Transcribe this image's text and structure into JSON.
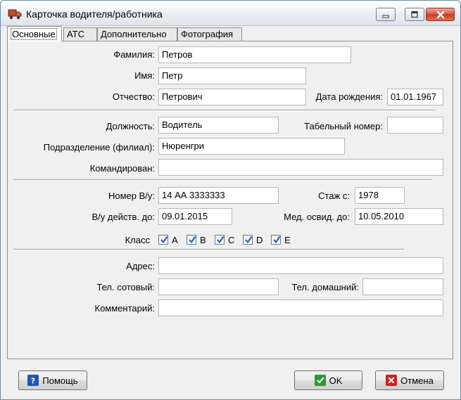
{
  "window": {
    "title": "Карточка водителя/работника"
  },
  "tabs": [
    {
      "label": "Основные",
      "active": true
    },
    {
      "label": "АТС"
    },
    {
      "label": "Дополнительно"
    },
    {
      "label": "Фотография"
    }
  ],
  "form": {
    "last_name": {
      "label": "Фамилия:",
      "value": "Петров"
    },
    "first_name": {
      "label": "Имя:",
      "value": "Петр"
    },
    "patronymic": {
      "label": "Отчество:",
      "value": "Петрович"
    },
    "birth_date": {
      "label": "Дата рождения:",
      "value": "01.01.1967"
    },
    "position": {
      "label": "Должность:",
      "value": "Водитель"
    },
    "personnel_number": {
      "label": "Табельный номер:",
      "value": ""
    },
    "division": {
      "label": "Подразделение (филиал):",
      "value": "Нюренгри"
    },
    "assigned": {
      "label": "Командирован:",
      "value": ""
    },
    "license_number": {
      "label": "Номер В/у:",
      "value": "14 АА 3333333"
    },
    "experience_since": {
      "label": "Стаж с:",
      "value": "1978"
    },
    "license_valid": {
      "label": "В/у действ. до:",
      "value": "09.01.2015"
    },
    "medical_until": {
      "label": "Мед. освид. до:",
      "value": "10.05.2010"
    },
    "class_label": "Класс",
    "classes": [
      {
        "label": "A",
        "checked": true
      },
      {
        "label": "B",
        "checked": true
      },
      {
        "label": "C",
        "checked": true
      },
      {
        "label": "D",
        "checked": true
      },
      {
        "label": "E",
        "checked": true
      }
    ],
    "address": {
      "label": "Адрес:",
      "value": ""
    },
    "mobile_phone": {
      "label": "Тел. сотовый:",
      "value": ""
    },
    "home_phone": {
      "label": "Тел. домашний:",
      "value": ""
    },
    "comment": {
      "label": "Комментарий:",
      "value": ""
    }
  },
  "buttons": {
    "help": "Помощь",
    "ok": "OK",
    "cancel": "Отмена"
  },
  "icons": {
    "app": "truck-icon",
    "help": "help-icon",
    "ok": "check-icon",
    "cancel": "cross-icon"
  },
  "colors": {
    "check": "#2a5aa8",
    "ok_icon": "#2e9a2e",
    "cancel_icon": "#c92424",
    "help_icon": "#1e56b4",
    "close_button": "#c7402a"
  }
}
